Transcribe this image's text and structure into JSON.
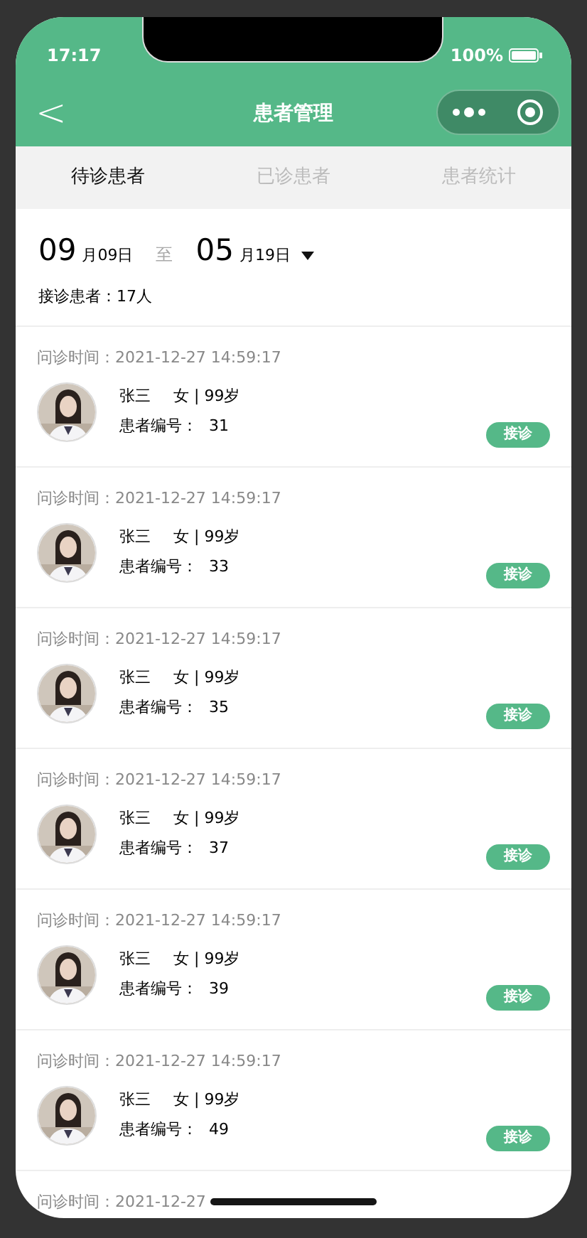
{
  "status_bar": {
    "time": "17:17",
    "battery": "100%"
  },
  "nav": {
    "back": "<",
    "title": "患者管理"
  },
  "tabs": [
    {
      "label": "待诊患者",
      "selected": true
    },
    {
      "label": "已诊患者",
      "selected": false
    },
    {
      "label": "患者统计",
      "selected": false
    }
  ],
  "date_range": {
    "start_big": "09",
    "start_small": "月09日",
    "separator": "至",
    "end_big": "05",
    "end_small": "月19日"
  },
  "count": "接诊患者：17人",
  "patients": [
    {
      "time_label": "问诊时间：",
      "time": "2021-12-27 14:59:17",
      "name": "张三",
      "info": "女 | 99岁",
      "id_label": "患者编号：",
      "id": "31",
      "action": "接诊"
    },
    {
      "time_label": "问诊时间：",
      "time": "2021-12-27 14:59:17",
      "name": "张三",
      "info": "女 | 99岁",
      "id_label": "患者编号：",
      "id": "33",
      "action": "接诊"
    },
    {
      "time_label": "问诊时间：",
      "time": "2021-12-27 14:59:17",
      "name": "张三",
      "info": "女 | 99岁",
      "id_label": "患者编号：",
      "id": "35",
      "action": "接诊"
    },
    {
      "time_label": "问诊时间：",
      "time": "2021-12-27 14:59:17",
      "name": "张三",
      "info": "女 | 99岁",
      "id_label": "患者编号：",
      "id": "37",
      "action": "接诊"
    },
    {
      "time_label": "问诊时间：",
      "time": "2021-12-27 14:59:17",
      "name": "张三",
      "info": "女 | 99岁",
      "id_label": "患者编号：",
      "id": "39",
      "action": "接诊"
    },
    {
      "time_label": "问诊时间：",
      "time": "2021-12-27 14:59:17",
      "name": "张三",
      "info": "女 | 99岁",
      "id_label": "患者编号：",
      "id": "49",
      "action": "接诊"
    },
    {
      "time_label": "问诊时间：",
      "time": "2021-12-27"
    }
  ]
}
